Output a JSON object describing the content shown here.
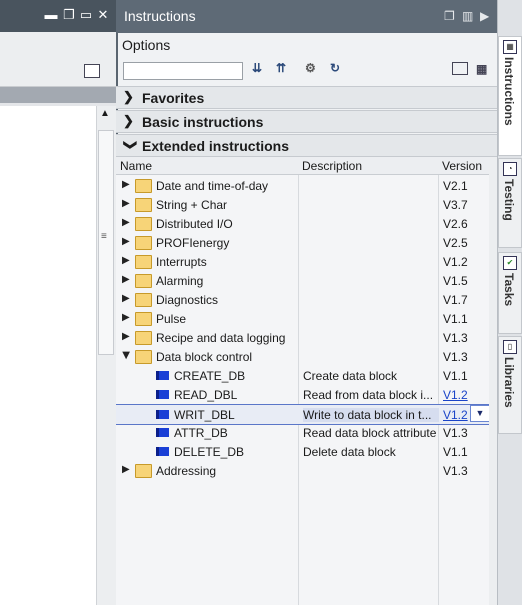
{
  "window": {
    "minimize_icon": "minimize-icon",
    "restore_icon": "restore-icon",
    "maximize_icon": "maximize-icon",
    "close_icon": "close-icon"
  },
  "panel": {
    "title": "Instructions",
    "options_label": "Options",
    "search_value": ""
  },
  "sections": [
    {
      "label": "Favorites",
      "expanded": false
    },
    {
      "label": "Basic instructions",
      "expanded": false
    },
    {
      "label": "Extended instructions",
      "expanded": true
    }
  ],
  "columns": {
    "name": "Name",
    "description": "Description",
    "version": "Version"
  },
  "rows": [
    {
      "name": "Date and time-of-day",
      "description": "",
      "version": "V2.1"
    },
    {
      "name": "String + Char",
      "description": "",
      "version": "V3.7"
    },
    {
      "name": "Distributed I/O",
      "description": "",
      "version": "V2.6"
    },
    {
      "name": "PROFIenergy",
      "description": "",
      "version": "V2.5"
    },
    {
      "name": "Interrupts",
      "description": "",
      "version": "V1.2"
    },
    {
      "name": "Alarming",
      "description": "",
      "version": "V1.5"
    },
    {
      "name": "Diagnostics",
      "description": "",
      "version": "V1.7"
    },
    {
      "name": "Pulse",
      "description": "",
      "version": "V1.1"
    },
    {
      "name": "Recipe and data logging",
      "description": "",
      "version": "V1.3"
    },
    {
      "name": "Data block control",
      "description": "",
      "version": "V1.3"
    },
    {
      "name": "CREATE_DB",
      "description": "Create data block",
      "version": "V1.1"
    },
    {
      "name": "READ_DBL",
      "description": "Read from data block i...",
      "version": "V1.2"
    },
    {
      "name": "WRIT_DBL",
      "description": "Write to data block in t...",
      "version": "V1.2"
    },
    {
      "name": "ATTR_DB",
      "description": "Read data block attribute",
      "version": "V1.3"
    },
    {
      "name": "DELETE_DB",
      "description": "Delete data block",
      "version": "V1.1"
    },
    {
      "name": "Addressing",
      "description": "",
      "version": "V1.3"
    }
  ],
  "right_tabs": [
    {
      "label": "Instructions",
      "icon": "instructions-icon"
    },
    {
      "label": "Testing",
      "icon": "testing-icon"
    },
    {
      "label": "Tasks",
      "icon": "tasks-icon"
    },
    {
      "label": "Libraries",
      "icon": "libraries-icon"
    }
  ]
}
